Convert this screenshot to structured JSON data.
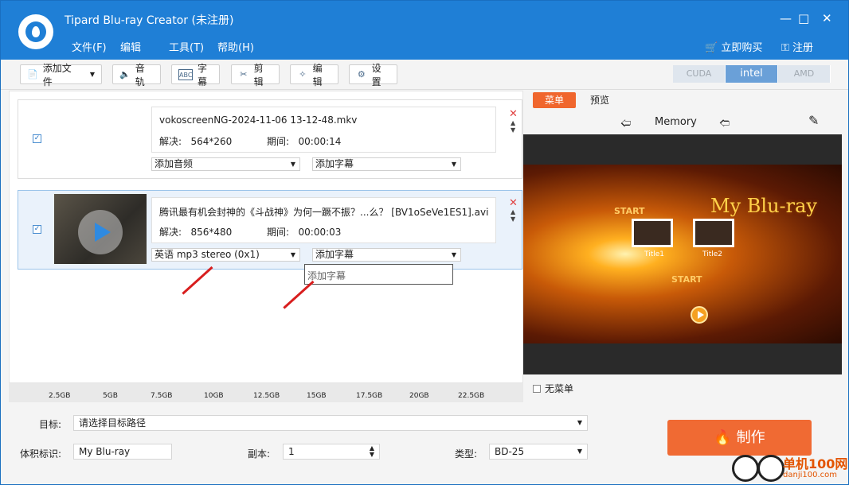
{
  "window": {
    "title": "Tipard Blu-ray Creator (未注册)",
    "minimize_icon": "minimize-icon",
    "maximize_icon": "maximize-icon",
    "close_icon": "close-icon"
  },
  "menu": [
    "文件(F)",
    "编辑",
    "工具(T)",
    "帮助(H)"
  ],
  "header_actions": {
    "buy": "立即购买",
    "register": "注册"
  },
  "toolbar": {
    "add_file": "添加文件",
    "audio": "音轨",
    "subtitle": "字幕",
    "trim": "剪辑",
    "edit": "编辑",
    "settings": "设置"
  },
  "accel": [
    "CUDA",
    "intel",
    "AMD"
  ],
  "files": [
    {
      "name": "vokoscreenNG-2024-11-06 13-12-48.mkv",
      "res_label": "解决:",
      "res": "564*260",
      "dur_label": "期间:",
      "dur": "00:00:14",
      "audio": "添加音频",
      "subtitle": "添加字幕"
    },
    {
      "name": "腾讯最有机会封神的《斗战神》为何一蹶不振？...么？ [BV1oSeVe1ES1].avi",
      "res_label": "解决:",
      "res": "856*480",
      "dur_label": "期间:",
      "dur": "00:00:03",
      "audio": "英语 mp3 stereo (0x1)",
      "subtitle": "添加字幕",
      "dropdown_option": "添加字幕"
    }
  ],
  "scale": [
    "2.5GB",
    "5GB",
    "7.5GB",
    "10GB",
    "12.5GB",
    "15GB",
    "17.5GB",
    "20GB",
    "22.5GB"
  ],
  "right": {
    "tab_menu": "菜单",
    "tab_preview": "预览",
    "template": "Memory",
    "poster_title": "My Blu-ray",
    "title1": "Title1",
    "title2": "Title2",
    "start": "START",
    "no_menu": "无菜单"
  },
  "bottom": {
    "target_label": "目标:",
    "target_value": "请选择目标路径",
    "volume_label": "体积标识:",
    "volume_value": "My Blu-ray",
    "copies_label": "副本:",
    "copies_value": "1",
    "type_label": "类型:",
    "type_value": "BD-25",
    "make_button": "制作"
  },
  "watermark": {
    "line1": "单机100网",
    "line2": "danji100.com"
  },
  "colors": {
    "titlebar": "#1f7fd6",
    "accent": "#f06a33"
  }
}
